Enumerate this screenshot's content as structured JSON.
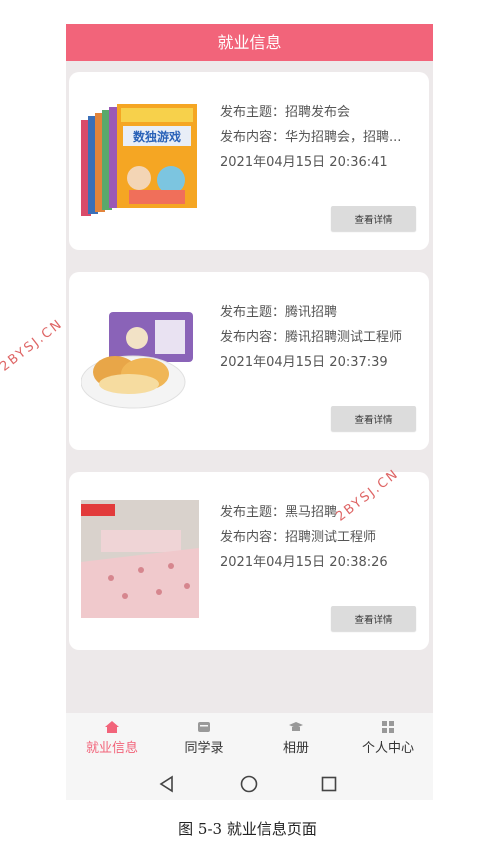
{
  "header": {
    "title": "就业信息"
  },
  "jobs": [
    {
      "subject_label": "发布主题：",
      "subject": "招聘发布会",
      "content_label": "发布内容：",
      "content": "华为招聘会，招聘...",
      "time": "2021年04月15日 20:36:41",
      "button": "查看详情",
      "thumb_text": "数独游戏"
    },
    {
      "subject_label": "发布主题：",
      "subject": "腾讯招聘",
      "content_label": "发布内容：",
      "content": "腾讯招聘测试工程师",
      "time": "2021年04月15日 20:37:39",
      "button": "查看详情"
    },
    {
      "subject_label": "发布主题：",
      "subject": "黑马招聘",
      "content_label": "发布内容：",
      "content": "招聘测试工程师",
      "time": "2021年04月15日 20:38:26",
      "button": "查看详情"
    }
  ],
  "tabbar": {
    "items": [
      {
        "label": "就业信息",
        "icon": "home-icon",
        "active": true
      },
      {
        "label": "同学录",
        "icon": "contacts-icon",
        "active": false
      },
      {
        "label": "相册",
        "icon": "graduation-cap-icon",
        "active": false
      },
      {
        "label": "个人中心",
        "icon": "grid-icon",
        "active": false
      }
    ]
  },
  "system_nav": {
    "icons": [
      "back-triangle-icon",
      "home-circle-icon",
      "recents-square-icon"
    ]
  },
  "caption": "图 5-3 就业信息页面",
  "watermarks": [
    "2BYSJ.CN",
    "2BYSJ.CN"
  ],
  "colors": {
    "accent": "#f2647a",
    "background": "#ede9ea",
    "button": "#dcdcdc"
  }
}
